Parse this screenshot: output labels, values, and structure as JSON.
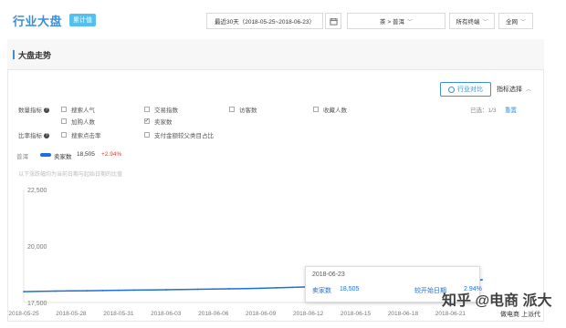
{
  "header": {
    "title": "行业大盘",
    "tag": "累计值",
    "date_range": "最近30天（2018-05-25~2018-06-23）",
    "category": "茶 > 普洱",
    "device": "所有终端",
    "region": "全网"
  },
  "panel": {
    "title": "大盘走势",
    "compare_button": "行业对比",
    "metric_select": "指标选择",
    "selected_count": "已选：1/3",
    "reset": "重置"
  },
  "metrics": {
    "quantity_label": "数量指标",
    "ratio_label": "比率指标",
    "items": [
      {
        "label": "搜索人气",
        "checked": false
      },
      {
        "label": "交易指数",
        "checked": false
      },
      {
        "label": "访客数",
        "checked": false
      },
      {
        "label": "收藏人数",
        "checked": false
      },
      {
        "label": "加购人数",
        "checked": false
      },
      {
        "label": "卖家数",
        "checked": true
      },
      {
        "label": "搜索点击率",
        "checked": false
      },
      {
        "label": "支付金额较父类目占比",
        "checked": false
      }
    ],
    "checked_mark": "✓"
  },
  "legend": {
    "label": "普洱",
    "series": "卖家数",
    "value": "18,505",
    "change": "+2.94%",
    "hint": "以下涨跌幅均为当前日期与起始日期的比值"
  },
  "chart_data": {
    "type": "line",
    "series": [
      {
        "name": "卖家数",
        "color": "#1e6fd9",
        "x": [
          "2018-05-25",
          "2018-05-26",
          "2018-05-27",
          "2018-05-28",
          "2018-05-29",
          "2018-05-30",
          "2018-05-31",
          "2018-06-01",
          "2018-06-02",
          "2018-06-03",
          "2018-06-04",
          "2018-06-05",
          "2018-06-06",
          "2018-06-07",
          "2018-06-08",
          "2018-06-09",
          "2018-06-10",
          "2018-06-11",
          "2018-06-12",
          "2018-06-13",
          "2018-06-14",
          "2018-06-15",
          "2018-06-16",
          "2018-06-17",
          "2018-06-18",
          "2018-06-19",
          "2018-06-20",
          "2018-06-21",
          "2018-06-22",
          "2018-06-23"
        ],
        "values": [
          17980,
          17995,
          18005,
          18015,
          18020,
          18030,
          18040,
          18050,
          18055,
          18065,
          18075,
          18085,
          18095,
          18105,
          18115,
          18130,
          18150,
          18170,
          18190,
          18210,
          18230,
          18250,
          18270,
          18290,
          18320,
          18350,
          18380,
          18420,
          18460,
          18505
        ]
      }
    ],
    "yticks": [
      "22,500",
      "20,000",
      "17,500"
    ],
    "ylim": [
      17500,
      22500
    ],
    "xticks": [
      "2018-05-25",
      "2018-05-28",
      "2018-05-31",
      "2018-06-03",
      "2018-06-06",
      "2018-06-09",
      "2018-06-12",
      "2018-06-15",
      "2018-06-18",
      "2018-06-21"
    ],
    "grid": false
  },
  "tooltip": {
    "date": "2018-06-23",
    "series": "卖家数",
    "value": "18,505",
    "compare": "较开始日期",
    "change": "2.94%"
  },
  "watermark": {
    "line1": "知乎 @电商 派大",
    "line2": "做电商 上派代"
  }
}
